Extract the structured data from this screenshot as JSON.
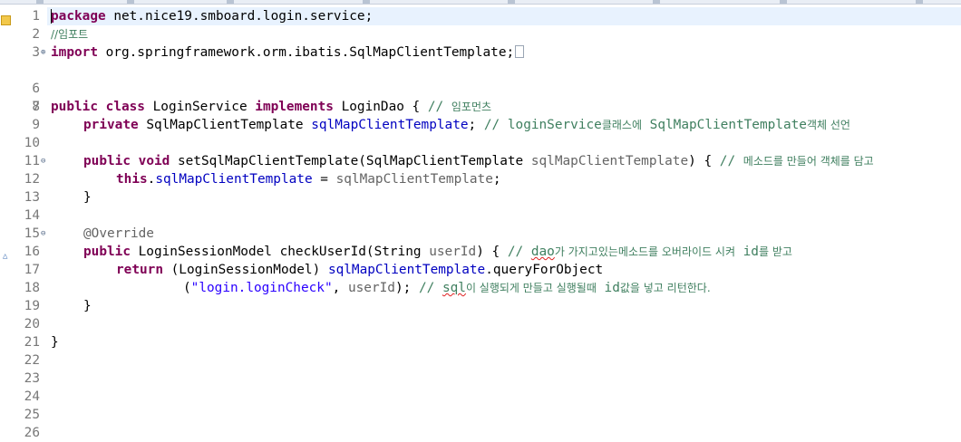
{
  "editor": {
    "line_numbers": [
      "1",
      "2",
      "3",
      "6",
      "7",
      "8",
      "9",
      "10",
      "11",
      "12",
      "13",
      "14",
      "15",
      "16",
      "17",
      "18",
      "19",
      "20",
      "21",
      "22",
      "23",
      "24",
      "25",
      "26"
    ],
    "fold_markers": {
      "l3": "⊕",
      "l11": "⊖",
      "l15": "⊖"
    },
    "lines": {
      "l1": {
        "kw": "package",
        "rest": " net.nice19.smboard.login.service;"
      },
      "l2": {
        "cm": "//임포트"
      },
      "l3": {
        "kw": "import",
        "rest": " org.springframework.orm.ibatis.SqlMapClientTemplate;"
      },
      "l8": {
        "kw1": "public",
        "kw2": "class",
        "name": " LoginService ",
        "kw3": "implements",
        "rest": " LoginDao { ",
        "cm_prefix": "// ",
        "cm_ko": "임포먼츠"
      },
      "l9": {
        "kw": "private",
        "type": " SqlMapClientTemplate ",
        "field": "sqlMapClientTemplate",
        "rest": "; ",
        "cm_prefix": "// loginService",
        "cm_ko1": "클래스에",
        "cm_mid": " SqlMapClientTemplate",
        "cm_ko2": "객체 선언"
      },
      "l11": {
        "kw1": "public",
        "kw2": "void",
        "name": " setSqlMapClientTemplate(SqlMapClientTemplate ",
        "param": "sqlMapClientTemplate",
        "rest": ") { ",
        "cm_prefix": "// ",
        "cm_ko": "메소드를 만들어 객체를 담고"
      },
      "l12": {
        "kw": "this",
        "dot": ".",
        "field": "sqlMapClientTemplate",
        "rest": " = ",
        "param": "sqlMapClientTemplate",
        "end": ";"
      },
      "l13": {
        "text": "}"
      },
      "l15": {
        "ann": "@Override"
      },
      "l16": {
        "kw": "public",
        "name": " LoginSessionModel checkUserId(String ",
        "param": "userId",
        "rest": ") { ",
        "cm_prefix": "// ",
        "cm_dao": "dao",
        "cm_ko1": "가 가지고있는메소드를 오버라이드 시켜",
        "cm_id": " id",
        "cm_ko2": "를 받고"
      },
      "l17": {
        "kw": "return",
        "rest": " (LoginSessionModel) ",
        "field": "sqlMapClientTemplate",
        "end": ".queryForObject"
      },
      "l18": {
        "open": "(",
        "str": "\"login.loginCheck\"",
        "mid": ", ",
        "param": "userId",
        "rest": "); ",
        "cm_prefix": "// ",
        "cm_sql": "sql",
        "cm_ko1": "이 실행되게 만들고 실행될때",
        "cm_id": " id",
        "cm_ko2": "값을 넣고 리턴한다."
      },
      "l19": {
        "text": "}"
      },
      "l21": {
        "text": "}"
      }
    }
  },
  "colors": {
    "keyword": "#7f0055",
    "comment": "#3f7f5f",
    "field": "#0000c0",
    "string": "#2a00ff",
    "annotation": "#646464",
    "line_number": "#787878",
    "current_line": "#e8f2fe"
  },
  "icons": {
    "bookmark": "bookmark-icon",
    "override": "override-triangle-icon",
    "collapsed_import": "collapsed-code-icon"
  }
}
